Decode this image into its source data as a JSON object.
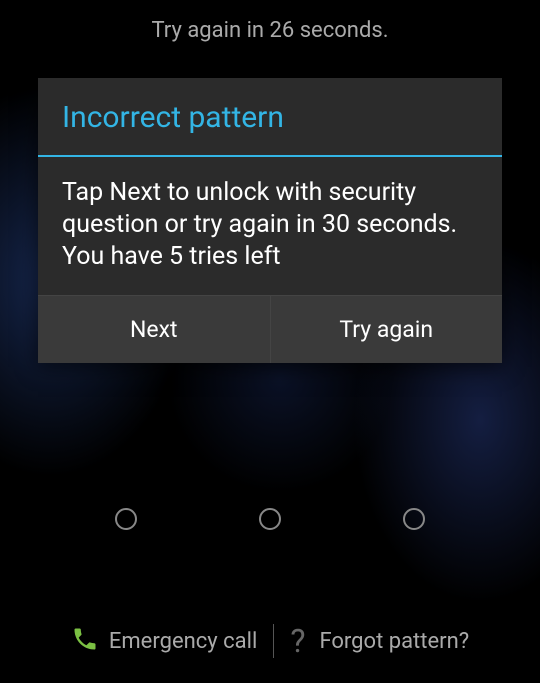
{
  "countdown_text": "Try again in 26 seconds.",
  "dialog": {
    "title": "Incorrect pattern",
    "message": "Tap Next to unlock with security question or try again in 30 seconds. You have 5 tries left",
    "buttons": {
      "next": "Next",
      "try_again": "Try again"
    }
  },
  "footer": {
    "emergency_call": "Emergency call",
    "forgot_pattern": "Forgot pattern?"
  }
}
